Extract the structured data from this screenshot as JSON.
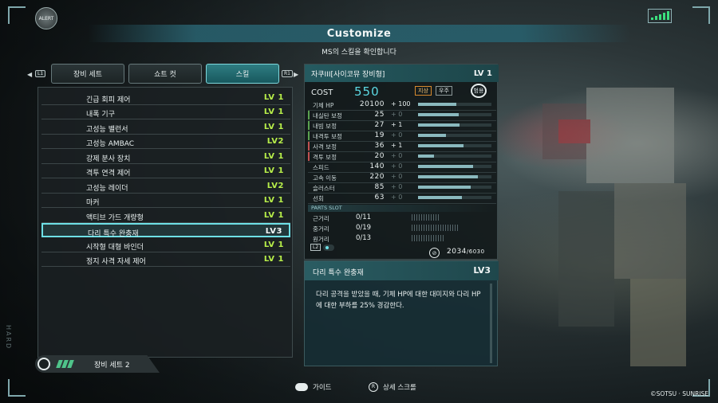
{
  "alert": "ALERT",
  "header": {
    "title": "Customize",
    "subtitle": "MS의 스킬을 확인합니다"
  },
  "tabs": {
    "left_button": "L1",
    "right_button": "R1",
    "items": [
      {
        "label": "장비 세트"
      },
      {
        "label": "쇼트 컷"
      },
      {
        "label": "스킬"
      }
    ],
    "active_index": 2
  },
  "skills": [
    {
      "name": "긴급 회피 제어",
      "level": "LV 1"
    },
    {
      "name": "내폭 기구",
      "level": "LV 1"
    },
    {
      "name": "고성능 밸런서",
      "level": "LV 1"
    },
    {
      "name": "고성능 AMBAC",
      "level": "LV2"
    },
    {
      "name": "강제 분사 장치",
      "level": "LV 1"
    },
    {
      "name": "격투 연격 제어",
      "level": "LV 1"
    },
    {
      "name": "고성능 레이더",
      "level": "LV2"
    },
    {
      "name": "마커",
      "level": "LV 1"
    },
    {
      "name": "액티브 가드 개량형",
      "level": "LV 1"
    },
    {
      "name": "다리 특수 완충재",
      "level": "LV3"
    },
    {
      "name": "시작형 대형 바인더",
      "level": "LV 1"
    },
    {
      "name": "정지 사격 자세 제어",
      "level": "LV 1"
    }
  ],
  "selected_skill_index": 9,
  "equipment_set": {
    "label": "장비 세트 2"
  },
  "unit": {
    "name": "자쿠III[사이코뮤 장비형]",
    "level": "LV 1",
    "cost_label": "COST",
    "cost": "550",
    "environments": [
      "지상",
      "우주",
      "범용"
    ],
    "stats": [
      {
        "name": "기체 HP",
        "value": "20100",
        "mod": "+ 100",
        "mod_active": true,
        "fill": 0.52,
        "accent": ""
      },
      {
        "name": "내실탄 보정",
        "value": "25",
        "mod": "+ 0",
        "mod_active": false,
        "fill": 0.55,
        "accent": "#5aa34f"
      },
      {
        "name": "내빔 보정",
        "value": "27",
        "mod": "+ 1",
        "mod_active": true,
        "fill": 0.57,
        "accent": "#5aa34f"
      },
      {
        "name": "내격투 보정",
        "value": "19",
        "mod": "+ 0",
        "mod_active": false,
        "fill": 0.38,
        "accent": "#5aa34f"
      },
      {
        "name": "사격 보정",
        "value": "36",
        "mod": "+ 1",
        "mod_active": true,
        "fill": 0.62,
        "accent": "#c25151"
      },
      {
        "name": "격투 보정",
        "value": "20",
        "mod": "+ 0",
        "mod_active": false,
        "fill": 0.22,
        "accent": "#c25151"
      },
      {
        "name": "스피드",
        "value": "140",
        "mod": "+ 0",
        "mod_active": false,
        "fill": 0.75,
        "accent": ""
      },
      {
        "name": "고속 이동",
        "value": "220",
        "mod": "+ 0",
        "mod_active": false,
        "fill": 0.82,
        "accent": ""
      },
      {
        "name": "슬러스터",
        "value": "85",
        "mod": "+ 0",
        "mod_active": false,
        "fill": 0.72,
        "accent": ""
      },
      {
        "name": "선회",
        "value": "63",
        "mod": "+ 0",
        "mod_active": false,
        "fill": 0.6,
        "accent": ""
      }
    ],
    "parts_slot_label": "PARTS SLOT",
    "parts_slots": [
      {
        "name": "근거리",
        "value": "0/11",
        "capacity": 11
      },
      {
        "name": "중거리",
        "value": "0/19",
        "capacity": 19
      },
      {
        "name": "원거리",
        "value": "0/13",
        "capacity": 13
      }
    ],
    "l2_button": "L2",
    "total_cost": "2034",
    "total_cost_max": "/6030"
  },
  "description": {
    "name": "다리 특수 완충재",
    "level": "LV3",
    "text": "다리 공격을 받았을 때, 기체 HP에 대한 대미지와 다리 HP에 대한 부하를 25% 경감한다."
  },
  "footer": {
    "guide_label": "가이드",
    "scroll_label": "상세 스크롤",
    "copyright": "©SOTSU · SUNRISE"
  },
  "difficulty_watermark": "HARD",
  "colors": {
    "accent": "#6ee0e6",
    "level_green": "#b8ef4a",
    "cost": "#5cd9e3"
  }
}
